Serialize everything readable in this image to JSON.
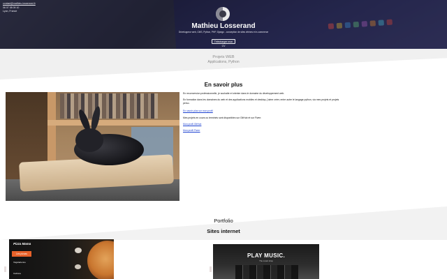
{
  "contact": {
    "email": "contact@mathieu-losserand.fr",
    "phone": "06 07 08 09 10",
    "city": "Lyon, France"
  },
  "hero": {
    "name": "Mathieu Losserand",
    "tagline": "Développeur web, CMS, Python, PHP, Django - conception de sites vitrines et e-commerce",
    "cv_button": "Télécharger mon CV"
  },
  "band": {
    "line1": "Projets WEB",
    "line2": "Applications, Python"
  },
  "about": {
    "title": "En savoir plus",
    "photo_alt": "Lapin noir sur un coussin",
    "p1": "En reconversion professionnelle, je souhaite m'orienter dans le domaine du développement web.",
    "p2": "En formation dans les domaines du web et des applications mobiles et desktop, j'aime créer, entre autre le langage python, via mes projets et projets perso.",
    "link1": "En savoir plus sur mon profil",
    "p3": "Mes projets en cours ou terminés sont disponibles sur GitHub et sur Fiverr.",
    "link2": "Mon profil GitHub",
    "link3": "Mon profil Fiverr"
  },
  "portfolio": {
    "title": "Portfolio",
    "subtitle": "Sites internet",
    "cards": [
      {
        "brand": "Pizza Mama",
        "cta": "Les pizzas",
        "item1": "Végétarienne",
        "item2": "Calzone"
      },
      {
        "title": "PLAY MUSIC.",
        "subtitle": "The music shop"
      }
    ]
  },
  "colors": {
    "hero_bg": "#2f3146",
    "band_bg": "#f0f0f0",
    "link": "#1a3fd0",
    "pizza_accent": "#e8622a"
  }
}
